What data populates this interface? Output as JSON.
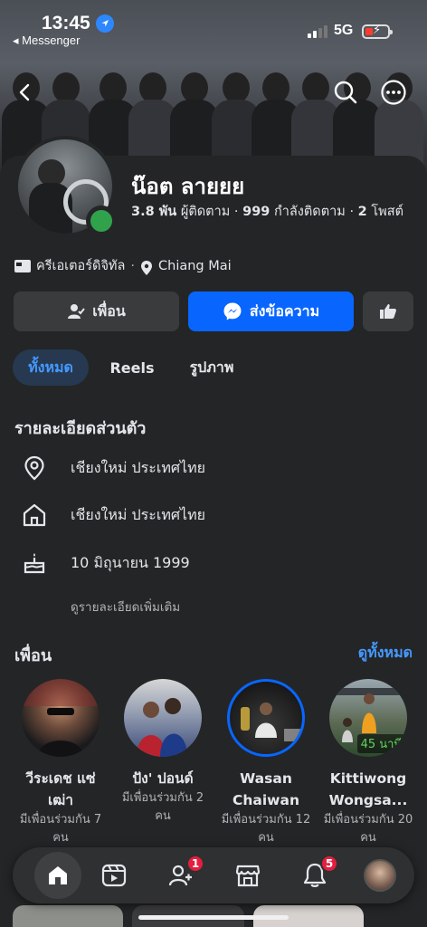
{
  "status_bar": {
    "time": "13:45",
    "back_app": "◂ Messenger",
    "network": "5G"
  },
  "profile": {
    "name": "น๊อต ลายยย",
    "followers_count": "3.8 พัน",
    "followers_label": "ผู้ติดตาม",
    "following_count": "999",
    "following_label": "กำลังติดตาม",
    "posts_count": "2",
    "posts_label": "โพสต์",
    "category": "ครีเอเตอร์ดิจิทัล",
    "location": "Chiang Mai",
    "online": true
  },
  "actions": {
    "friend_label": "เพื่อน",
    "message_label": "ส่งข้อความ"
  },
  "tabs": [
    {
      "label": "ทั้งหมด",
      "active": true
    },
    {
      "label": "Reels",
      "active": false
    },
    {
      "label": "รูปภาพ",
      "active": false
    }
  ],
  "details": {
    "title": "รายละเอียดส่วนตัว",
    "lives_in": "เชียงใหม่ ประเทศไทย",
    "hometown": "เชียงใหม่ ประเทศไทย",
    "birthday": "10 มิถุนายน  1999",
    "see_more": "ดูรายละเอียดเพิ่มเติม"
  },
  "friends": {
    "title": "เพื่อน",
    "see_all": "ดูทั้งหมด",
    "items": [
      {
        "name": "วีระเดช แซ่ เฒ่า",
        "mutual": "มีเพื่อนร่วมกัน 7 คน",
        "has_story": false
      },
      {
        "name": "ปัง' ปอนด์",
        "mutual": "มีเพื่อนร่วมกัน 2 คน",
        "has_story": false
      },
      {
        "name": "Wasan Chaiwan",
        "mutual": "มีเพื่อนร่วมกัน 12 คน",
        "has_story": true
      },
      {
        "name": "Kittiwong Wongsa...",
        "mutual": "มีเพื่อนร่วมกัน 20 คน",
        "has_story": false,
        "badge": "45 นาที"
      }
    ]
  },
  "bottom_nav": {
    "friends_badge": "1",
    "notifications_badge": "5"
  },
  "colors": {
    "accent": "#0866ff",
    "link": "#4599ff",
    "online": "#31a24c",
    "badge": "#e41e3f",
    "background": "#242526"
  }
}
